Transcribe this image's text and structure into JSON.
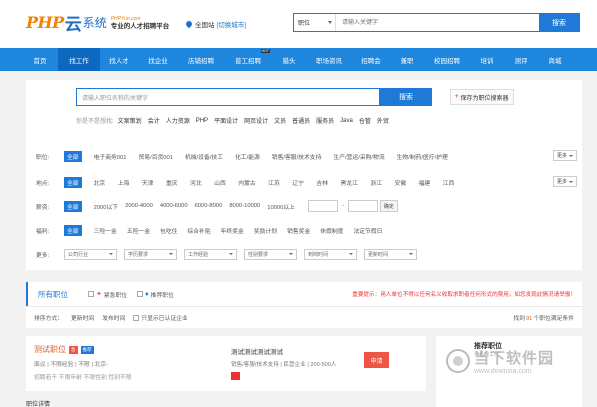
{
  "header": {
    "logo_php": "PHP",
    "logo_yun": "云",
    "logo_xt": "系统",
    "logo_url": "PHPYun.com",
    "logo_slogan": "专业的人才招聘平台",
    "site_label": "全国站",
    "site_switch": "[切换城市]",
    "search_type": "职位",
    "search_placeholder": "请输入关键字",
    "search_button": "搜索"
  },
  "nav": {
    "items": [
      {
        "label": "首页",
        "w": 36
      },
      {
        "label": "找工作",
        "w": 42
      },
      {
        "label": "找人才",
        "w": 38
      },
      {
        "label": "找企业",
        "w": 40
      },
      {
        "label": "店铺招聘",
        "w": 46
      },
      {
        "label": "普工招聘",
        "w": 48
      },
      {
        "label": "猎头",
        "w": 34
      },
      {
        "label": "职场资讯",
        "w": 46
      },
      {
        "label": "招聘会",
        "w": 38
      },
      {
        "label": "兼职",
        "w": 34
      },
      {
        "label": "校园招聘",
        "w": 46
      },
      {
        "label": "培训",
        "w": 34
      },
      {
        "label": "测评",
        "w": 34
      },
      {
        "label": "商城",
        "w": 34
      }
    ],
    "hot_badge": "HOT"
  },
  "main_search": {
    "placeholder": "请输入职位名称的关键字",
    "button": "搜索",
    "save_button": "保存为职位搜索器",
    "hot_label": "你是不是想找:",
    "hot_words": [
      "文案策划",
      "会计",
      "人力资源",
      "PHP",
      "平面设计",
      "网页设计",
      "文员",
      "普通员",
      "服务员",
      "Java",
      "仓管",
      "外贸"
    ]
  },
  "filters": {
    "all": "全部",
    "more": "更多",
    "job_label": "职位:",
    "job_options": [
      "电子商务001",
      "贸易/百货001",
      "机械/设备/技工",
      "化工/能源",
      "销售/客服/技术支持",
      "生产/营运/采购/物流",
      "生物/制药/医疗/护理"
    ],
    "area_label": "地点:",
    "area_options": [
      "北京",
      "上海",
      "天津",
      "重庆",
      "河北",
      "山西",
      "内蒙古",
      "江苏",
      "辽宁",
      "吉林",
      "黑龙江",
      "浙江",
      "安徽",
      "福建",
      "江西"
    ],
    "salary_label": "薪资:",
    "salary_options": [
      "2000以下",
      "2000-4000",
      "4000-6000",
      "6000-8000",
      "8000-10000",
      "10000以上"
    ],
    "salary_dash": "-",
    "salary_ok": "确定",
    "welfare_label": "福利:",
    "welfare_options": [
      "三险一金",
      "五险一金",
      "包吃住",
      "综合补贴",
      "年终奖金",
      "奖励计划",
      "销售奖金",
      "休假制度",
      "法定节假日"
    ],
    "more_label": "更多:",
    "dropdowns": [
      "公司行业",
      "学历要求",
      "工作经验",
      "性别要求",
      "到岗时间",
      "更新时间"
    ]
  },
  "results": {
    "tab_all": "所有职位",
    "urgent": "紧急职位",
    "recommend": "推荐职位",
    "tip": "重要提示：用人单位不得以任何名义收取求职者任何形式的费用，如您发现此情况请举报！",
    "sort_label": "排序方式：",
    "sort_update": "更新时间",
    "sort_publish": "发布时间",
    "only_auth": "只显示已认证企业",
    "count_prefix": "找到",
    "count_value": "91",
    "count_suffix": "个职位满足条件"
  },
  "job": {
    "title": "测试职位",
    "tag1": "急",
    "tag2": "推荐",
    "line2": "面议  |  不限经验  |  不限  |  北京-",
    "line3": "招聘若干  不限年龄  不限性别  性别不限",
    "company": "测试测试测试测试",
    "company_info": "销售/客服/技术支持 | 民营企业 | 200-500人",
    "apply": "申请",
    "rec_title": "推荐职位",
    "rec_sub": "手机找工作"
  },
  "watermark": {
    "zh": "当下软件园",
    "url": "www.downxia.com"
  },
  "footer": {
    "text": "职位详情"
  }
}
